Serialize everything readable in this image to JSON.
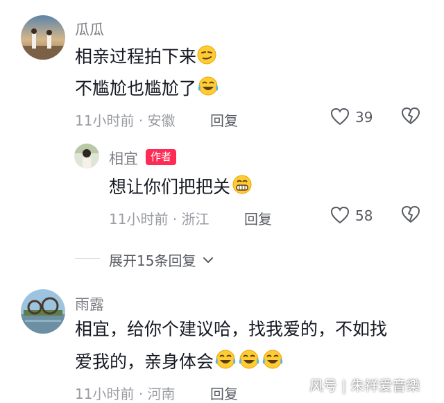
{
  "comments": [
    {
      "author": "瓜瓜",
      "lines": [
        "相亲过程拍下来",
        "不尴尬也尴尬了"
      ],
      "time": "11小时前",
      "region": "安徽",
      "reply_label": "回复",
      "likes": "39",
      "emojis": [
        "smirk-emoji",
        "laughing-tears-emoji"
      ]
    },
    {
      "author": "相宜",
      "badge": "作者",
      "lines": [
        "想让你们把把关"
      ],
      "time": "11小时前",
      "region": "浙江",
      "reply_label": "回复",
      "likes": "58",
      "emojis": [
        "grin-emoji"
      ]
    },
    {
      "author": "雨露",
      "lines": [
        "相宜，给你个建议哈，找我爱的，不如找",
        "爱我的，亲身体会"
      ],
      "time": "11小时前",
      "region": "河南",
      "reply_label": "回复",
      "emojis": [
        "laughing-tears-emoji",
        "laughing-tears-emoji",
        "laughing-tears-emoji"
      ]
    }
  ],
  "expand_replies": "展开15条回复",
  "separator": "·",
  "watermark": "风号 | 朱祥爱音樂",
  "colors": {
    "author_badge": "#fe2c55",
    "text": "#161823",
    "meta": "#9a9ca3"
  }
}
